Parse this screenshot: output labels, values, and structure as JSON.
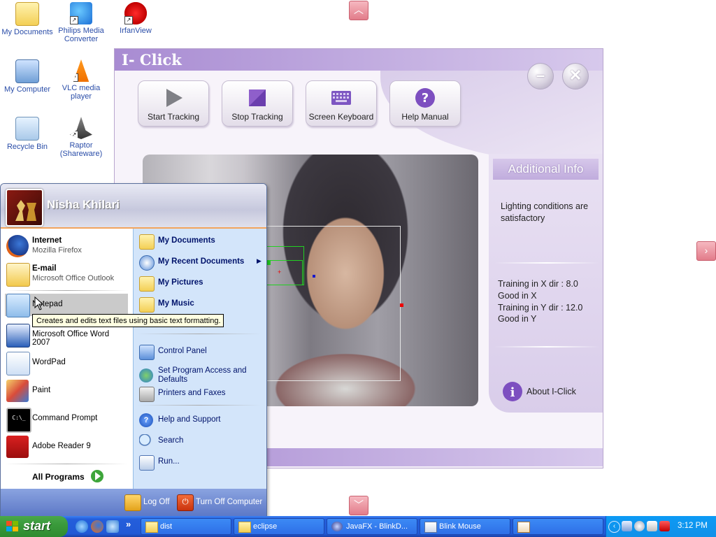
{
  "desktop": {
    "icons": [
      {
        "label": "My Documents",
        "icon": "folder-documents-icon"
      },
      {
        "label": "Philips Media Converter",
        "icon": "media-converter-icon"
      },
      {
        "label": "IrfanView",
        "icon": "irfanview-icon"
      },
      {
        "label": "My Computer",
        "icon": "computer-icon"
      },
      {
        "label": "VLC media player",
        "icon": "vlc-cone-icon"
      },
      {
        "label": "Recycle Bin",
        "icon": "recycle-bin-icon"
      },
      {
        "label": "Raptor (Shareware)",
        "icon": "raptor-icon"
      }
    ]
  },
  "iclick": {
    "title": "I- Click",
    "toolbar": [
      {
        "label": "Start Tracking",
        "icon": "play-icon"
      },
      {
        "label": "Stop Tracking",
        "icon": "stop-icon"
      },
      {
        "label": "Screen Keyboard",
        "icon": "keyboard-icon"
      },
      {
        "label": "Help Manual",
        "icon": "help-icon"
      }
    ],
    "info": {
      "heading": "Additional Info",
      "lighting": "Lighting conditions are satisfactory",
      "training_x": "Training in X dir : 8.0",
      "good_x": "Good in X",
      "training_y": "Training in Y dir : 12.0",
      "good_y": "Good in Y",
      "about": "About I-Click"
    }
  },
  "start_menu": {
    "user": "Nisha Khilari",
    "pinned": [
      {
        "title": "Internet",
        "subtitle": "Mozilla Firefox",
        "icon": "firefox-icon"
      },
      {
        "title": "E-mail",
        "subtitle": "Microsoft Office Outlook",
        "icon": "outlook-icon"
      }
    ],
    "recent": [
      {
        "title": "Notepad",
        "icon": "notepad-icon"
      },
      {
        "title": "Microsoft Office Word 2007",
        "icon": "word-icon"
      },
      {
        "title": "WordPad",
        "icon": "wordpad-icon"
      },
      {
        "title": "Paint",
        "icon": "paint-icon"
      },
      {
        "title": "Command Prompt",
        "icon": "command-prompt-icon"
      },
      {
        "title": "Adobe Reader 9",
        "icon": "adobe-reader-icon"
      }
    ],
    "all_programs": "All Programs",
    "right": [
      {
        "title": "My Documents",
        "icon": "folder-documents-icon"
      },
      {
        "title": "My Recent Documents",
        "icon": "recent-documents-icon"
      },
      {
        "title": "My Pictures",
        "icon": "folder-pictures-icon"
      },
      {
        "title": "My Music",
        "icon": "folder-music-icon"
      },
      {
        "title": "Control Panel",
        "icon": "control-panel-icon"
      },
      {
        "title": "Set Program Access and Defaults",
        "icon": "program-access-icon"
      },
      {
        "title": "Printers and Faxes",
        "icon": "printer-icon"
      },
      {
        "title": "Help and Support",
        "icon": "help-icon"
      },
      {
        "title": "Search",
        "icon": "search-icon"
      },
      {
        "title": "Run...",
        "icon": "run-icon"
      }
    ],
    "log_off": "Log Off",
    "turn_off": "Turn Off Computer",
    "tooltip": "Creates and edits text files using basic text formatting."
  },
  "taskbar": {
    "start": "start",
    "tasks": [
      {
        "label": "dist",
        "icon": "folder-icon"
      },
      {
        "label": "eclipse",
        "icon": "folder-icon"
      },
      {
        "label": "JavaFX - BlinkD...",
        "icon": "javafx-icon"
      },
      {
        "label": "Blink Mouse",
        "icon": "window-icon"
      },
      {
        "label": "",
        "icon": "java-icon"
      }
    ],
    "clock": "3:12 PM"
  },
  "colors": {
    "iclick_accent": "#a88bd2",
    "xp_blue": "#245edb",
    "start_green": "#3a9a3b"
  }
}
